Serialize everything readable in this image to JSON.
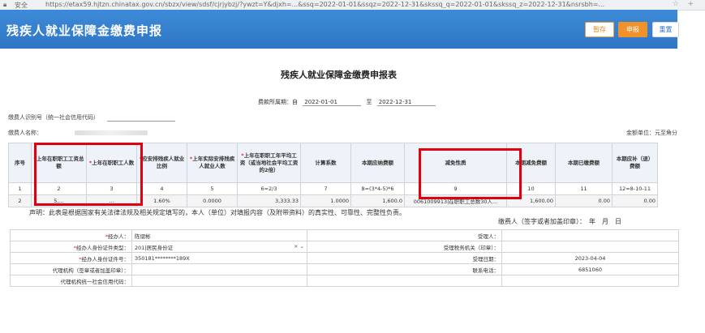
{
  "browser": {
    "secure_label": "安全",
    "url": "https://etax59.hjtzn.chinatax.gov.cn/sbzx/view/sdsf/cjrjybzj/?ywzt=Y&djxh=...&ssq=2022-01-01&ssqz=2022-12-31&skssq_q=2022-01-01&skssq_z=2022-12-31&nsrsbh=..."
  },
  "header": {
    "title": "残疾人就业保障金缴费申报",
    "save_label": "暂存",
    "submit_label": "申报",
    "reset_label": "重置"
  },
  "form": {
    "title": "残疾人就业保障金缴费申报表",
    "period_label": "费款所属期：自",
    "period_start": "2022-01-01",
    "period_to": "至",
    "period_end": "2022-12-31",
    "taxpayer_id_label": "缴费人识别号（统一社会信用代码）",
    "taxpayer_name_label": "缴费人名称：",
    "unit_label": "金额单位：元至角分"
  },
  "grid": {
    "headers": [
      {
        "text": "序号",
        "required": false
      },
      {
        "text": "上年在职职工工资总额",
        "required": true
      },
      {
        "text": "上年在职职工人数",
        "required": true
      },
      {
        "text": "应安排残疾人就业比例",
        "required": true
      },
      {
        "text": "上年实际安排残疾人就业人数",
        "required": true
      },
      {
        "text": "上年在职职工年平均工资（或当地社会平均工资的2倍）",
        "required": true
      },
      {
        "text": "计算系数",
        "required": false
      },
      {
        "text": "本期应纳费额",
        "required": false
      },
      {
        "text": "减免性质",
        "required": false
      },
      {
        "text": "本期减免费额",
        "required": false
      },
      {
        "text": "本期已缴费额",
        "required": false
      },
      {
        "text": "本期应补（退）费额",
        "required": false
      }
    ],
    "index_row": [
      "1",
      "2",
      "3",
      "4",
      "5",
      "6=2/3",
      "7",
      "8=(3*4-5)*6",
      "9",
      "10",
      "11",
      "12=8-10-11"
    ],
    "data_row": [
      "2",
      "5,...",
      "...",
      "1.60%",
      "0.0000",
      "3,333.33",
      "1.0000",
      "1,600.0",
      "0061009913|在职职工总数30人...",
      "1,600.00",
      "0.00",
      "0.00"
    ]
  },
  "declaration": "声明：此表是根据国家有关法律法规及相关规定填写的，本人（单位）对填报内容（及附带资料）的真实性、可靠性、完整性负责。",
  "signature": "缴费人（签字或者加盖印章）：　年　月　日",
  "agent": {
    "handler_label": "经办人：",
    "handler_value": "陈熠彬",
    "id_type_label": "经办人身份证件类型：",
    "id_type_value": "201|居民身份证",
    "id_number_label": "经办人身份证件号：",
    "id_number_value": "350181********189X",
    "agency_label": "代理机构（签章或者加盖印章）：",
    "agency_credit_label": "代理机构统一社会信用代码：",
    "receiver_label": "受理人：",
    "receiver_value": "",
    "tax_office_label": "受理税务机关（印章）：",
    "tax_office_value": "",
    "accept_date_label": "受理日期：",
    "accept_date_value": "2023-04-04",
    "phone_label": "联系电话：",
    "phone_value": "6851060"
  },
  "icons": {
    "lock": "lock-icon",
    "star": "star-icon",
    "clear": "clear-icon",
    "dropdown": "chevron-down-icon"
  }
}
